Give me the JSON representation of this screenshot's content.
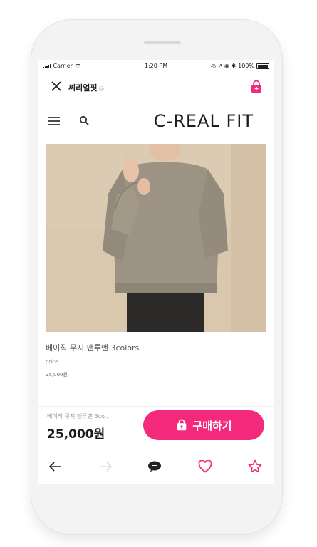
{
  "status_bar": {
    "carrier": "Carrier",
    "time": "1:20 PM",
    "battery": "100%"
  },
  "title_bar": {
    "shop_name": "씨리얼핏",
    "shop_mark": "◎"
  },
  "store": {
    "brand": "C-REAL FIT"
  },
  "product": {
    "name": "베이직 무지 맨투맨 3colors",
    "price_label": "price",
    "price": "25,000원"
  },
  "purchase_bar": {
    "item_name": "베이직 무지 맨투맨 3co..",
    "price": "25,000원",
    "buy_label": "구매하기"
  },
  "colors": {
    "accent": "#f5297c",
    "image_bg": "#d8c6ad"
  },
  "icons": [
    "close-icon",
    "shopping-bag-icon",
    "menu-icon",
    "search-icon",
    "back-arrow-icon",
    "forward-arrow-icon",
    "kakaotalk-icon",
    "heart-icon",
    "star-icon"
  ]
}
